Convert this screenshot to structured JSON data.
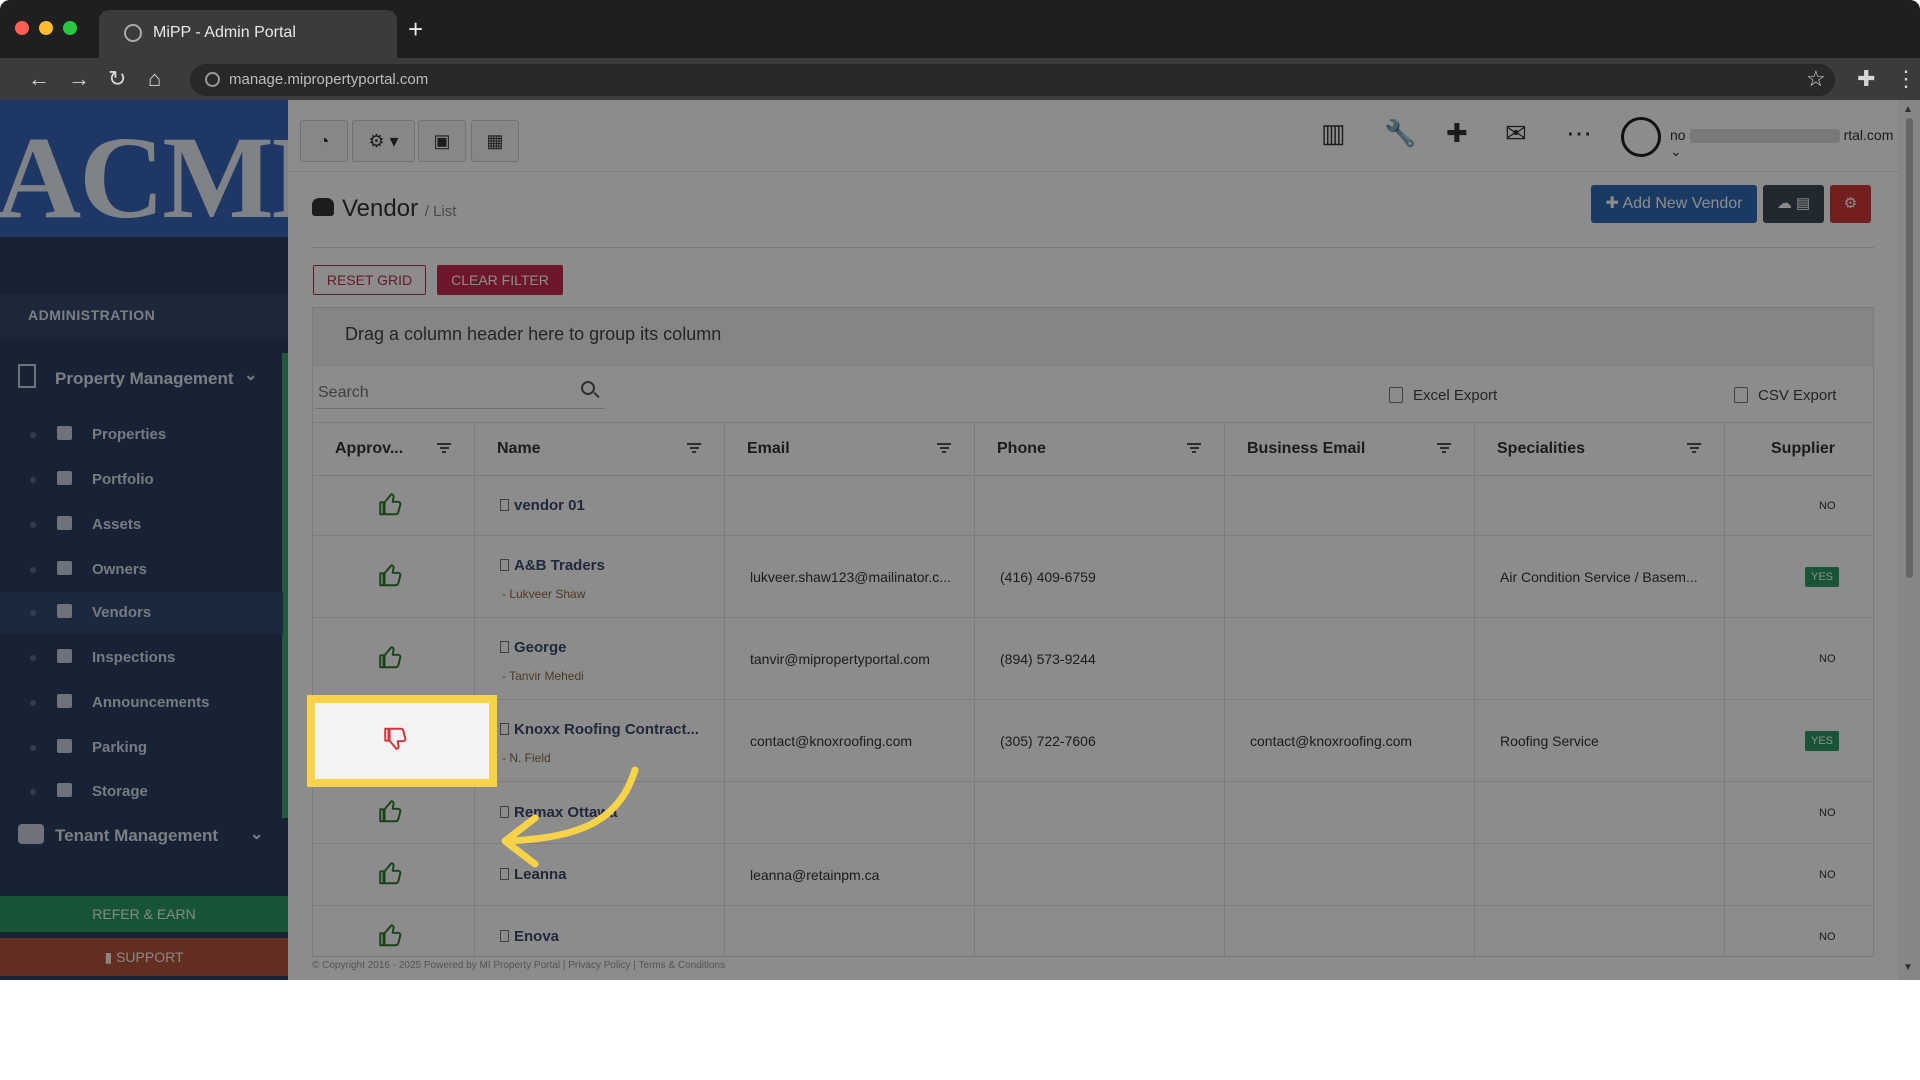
{
  "browser": {
    "tab_title": "MiPP - Admin Portal",
    "url": "manage.mipropertyportal.com"
  },
  "sidebar": {
    "logo_text": "ACME",
    "section_label": "ADMINISTRATION",
    "property_management": "Property Management",
    "items": [
      {
        "label": "Properties",
        "icon": "home-icon"
      },
      {
        "label": "Portfolio",
        "icon": "portfolio-icon"
      },
      {
        "label": "Assets",
        "icon": "archive-icon"
      },
      {
        "label": "Owners",
        "icon": "user-icon"
      },
      {
        "label": "Vendors",
        "icon": "briefcase-icon"
      },
      {
        "label": "Inspections",
        "icon": "search-icon"
      },
      {
        "label": "Announcements",
        "icon": "megaphone-icon"
      },
      {
        "label": "Parking",
        "icon": "car-icon"
      },
      {
        "label": "Storage",
        "icon": "storage-icon"
      }
    ],
    "tenant_management": "Tenant Management",
    "refer_label": "REFER & EARN",
    "support_label": "SUPPORT"
  },
  "topbar": {
    "user_email_prefix": "no",
    "user_email_suffix": "rtal.com"
  },
  "page": {
    "title": "Vendor",
    "breadcrumb": "/ List",
    "add_vendor_label": "Add New Vendor",
    "reset_grid_label": "RESET GRID",
    "clear_filter_label": "CLEAR FILTER"
  },
  "grid": {
    "group_panel_text": "Drag a column header here to group its column",
    "search_placeholder": "Search",
    "excel_export": "Excel Export",
    "csv_export": "CSV Export",
    "columns": [
      "Approv...",
      "Name",
      "Email",
      "Phone",
      "Business Email",
      "Specialities",
      "Supplier"
    ],
    "rows": [
      {
        "approved": true,
        "name": "vendor 01",
        "contact": "",
        "email": "",
        "phone": "",
        "business_email": "",
        "specialities": "",
        "supplier": "NO"
      },
      {
        "approved": true,
        "name": "A&B Traders",
        "contact": "- Lukveer Shaw",
        "email": "lukveer.shaw123@mailinator.c...",
        "phone": "(416) 409-6759",
        "business_email": "",
        "specialities": "Air Condition Service / Basem...",
        "supplier": "YES"
      },
      {
        "approved": true,
        "name": "George",
        "contact": "- Tanvir Mehedi",
        "email": "tanvir@mipropertyportal.com",
        "phone": "(894) 573-9244",
        "business_email": "",
        "specialities": "",
        "supplier": "NO"
      },
      {
        "approved": false,
        "name": "Knoxx Roofing Contract...",
        "contact": "- N. Field",
        "email": "contact@knoxroofing.com",
        "phone": "(305) 722-7606",
        "business_email": "contact@knoxroofing.com",
        "specialities": "Roofing Service",
        "supplier": "YES"
      },
      {
        "approved": true,
        "name": "Remax Ottawa",
        "contact": "",
        "email": "",
        "phone": "",
        "business_email": "",
        "specialities": "",
        "supplier": "NO"
      },
      {
        "approved": true,
        "name": "Leanna",
        "contact": "",
        "email": "leanna@retainpm.ca",
        "phone": "",
        "business_email": "",
        "specialities": "",
        "supplier": "NO"
      },
      {
        "approved": true,
        "name": "Enova",
        "contact": "",
        "email": "",
        "phone": "",
        "business_email": "",
        "specialities": "",
        "supplier": "NO"
      }
    ]
  },
  "footer": {
    "text": "© Copyright 2016 - 2025 Powered by MI Property Portal | Privacy Policy | Terms & Conditions"
  },
  "colors": {
    "sidebar_bg": "#2a3e5f",
    "primary": "#2e6bb5",
    "danger": "#c92a4d",
    "success": "#2d9a62",
    "highlight": "#f7d34a"
  }
}
